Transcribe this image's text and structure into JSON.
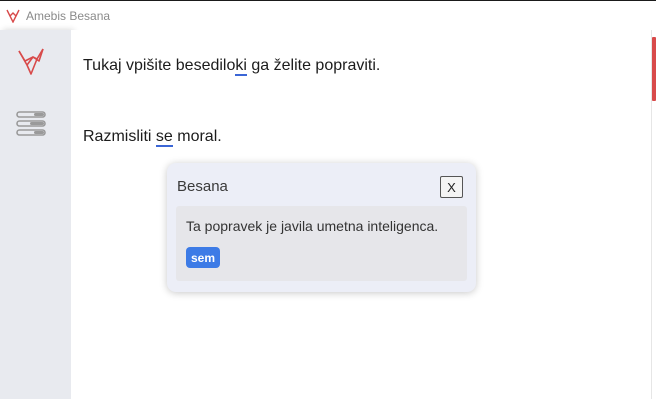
{
  "window": {
    "title": "Amebis Besana",
    "icon": "besana-logo-icon"
  },
  "sidebar": {
    "logo_icon": "besana-logo-icon",
    "menu_icon": "settings-menu-icon"
  },
  "editor": {
    "para1": {
      "before": "Tukaj vpišite besedilo",
      "error": "ki",
      "after": " ga želite popraviti."
    },
    "para2": {
      "before": "Razmisliti ",
      "error": "se",
      "after": " moral."
    }
  },
  "popup": {
    "title": "Besana",
    "close_label": "X",
    "message": "Ta popravek je javila umetna inteligenca.",
    "suggestion": "sem"
  },
  "colors": {
    "accent": "#3d7be6",
    "logo": "#d84a4a",
    "underline": "#3b66d6"
  }
}
